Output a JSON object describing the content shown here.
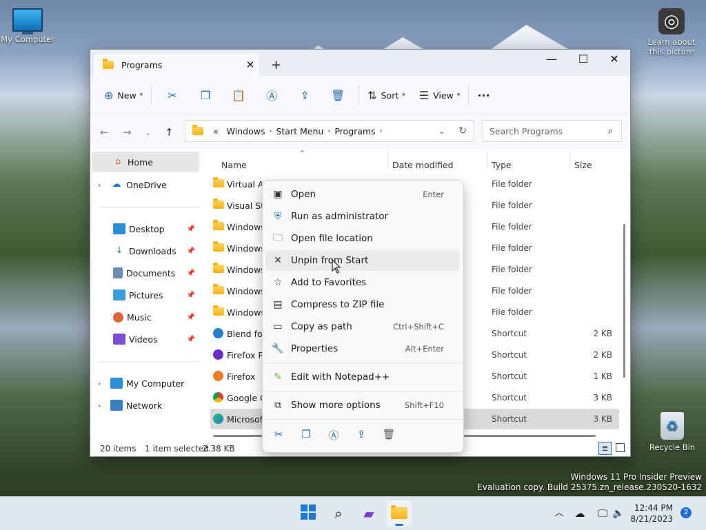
{
  "desktop": {
    "my_computer_label": "My Computer",
    "learn_label_1": "Learn about",
    "learn_label_2": "this picture",
    "recycle_bin_label": "Recycle Bin",
    "watermark_line1": "Windows 11 Pro Insider Preview",
    "watermark_line2": "Evaluation copy. Build 25375.zn_release.230520-1632"
  },
  "window": {
    "tab_title": "Programs",
    "new_tab_label": "+",
    "minimize": "—",
    "maximize": "☐",
    "close": "✕"
  },
  "toolbar": {
    "new_label": "New",
    "sort_label": "Sort",
    "view_label": "View",
    "more_label": "···"
  },
  "address": {
    "overflow": "«",
    "crumbs": [
      "Windows",
      "Start Menu",
      "Programs"
    ],
    "search_placeholder": "Search Programs"
  },
  "sidebar": {
    "home": "Home",
    "onedrive": "OneDrive",
    "desktop": "Desktop",
    "downloads": "Downloads",
    "documents": "Documents",
    "pictures": "Pictures",
    "music": "Music",
    "videos": "Videos",
    "my_computer": "My Computer",
    "network": "Network"
  },
  "columns": {
    "name": "Name",
    "date": "Date modified",
    "type": "Type",
    "size": "Size"
  },
  "files": [
    {
      "name": "Virtual Au",
      "type": "File folder",
      "size": "",
      "icon": "folder-icon"
    },
    {
      "name": "Visual Stu",
      "type": "File folder",
      "size": "",
      "icon": "folder-icon"
    },
    {
      "name": "Windows",
      "type": "File folder",
      "size": "",
      "icon": "folder-icon"
    },
    {
      "name": "Windows",
      "type": "File folder",
      "size": "",
      "icon": "folder-icon"
    },
    {
      "name": "Windows",
      "type": "File folder",
      "size": "",
      "icon": "folder-icon"
    },
    {
      "name": "Windows",
      "type": "File folder",
      "size": "",
      "icon": "folder-icon"
    },
    {
      "name": "Windows",
      "type": "File folder",
      "size": "",
      "icon": "folder-icon"
    },
    {
      "name": "Blend for",
      "type": "Shortcut",
      "size": "2 KB",
      "icon": "blend-icon"
    },
    {
      "name": "Firefox Pr",
      "type": "Shortcut",
      "size": "2 KB",
      "icon": "firefox-private-icon"
    },
    {
      "name": "Firefox",
      "type": "Shortcut",
      "size": "1 KB",
      "icon": "firefox-icon"
    },
    {
      "name": "Google Cl",
      "type": "Shortcut",
      "size": "3 KB",
      "icon": "chrome-icon"
    },
    {
      "name": "Microsoft",
      "type": "Shortcut",
      "size": "3 KB",
      "icon": "edge-icon"
    }
  ],
  "status": {
    "items": "20 items",
    "selected": "1 item selected",
    "selected_size": "2.38 KB"
  },
  "context_menu": {
    "open": "Open",
    "open_key": "Enter",
    "run_admin": "Run as administrator",
    "open_location": "Open file location",
    "unpin": "Unpin from Start",
    "favorites": "Add to Favorites",
    "compress": "Compress to ZIP file",
    "copy_path": "Copy as path",
    "copy_path_key": "Ctrl+Shift+C",
    "properties": "Properties",
    "properties_key": "Alt+Enter",
    "notepad": "Edit with Notepad++",
    "more_options": "Show more options",
    "more_options_key": "Shift+F10"
  },
  "taskbar": {
    "time": "12:44 PM",
    "date": "8/21/2023",
    "notification_count": "2"
  }
}
